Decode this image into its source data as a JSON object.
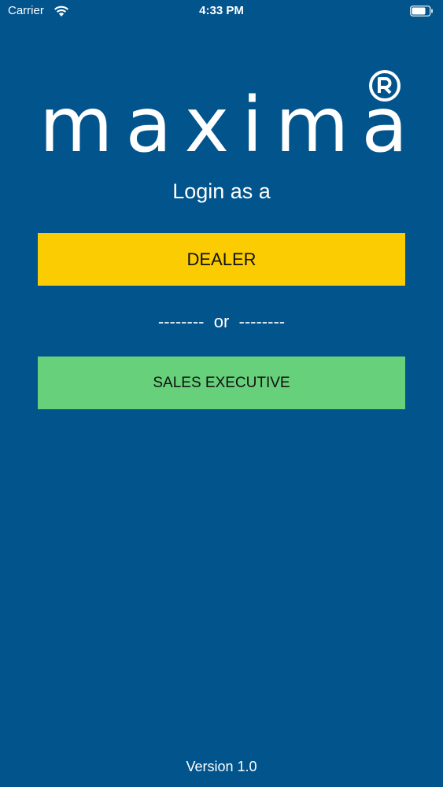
{
  "status_bar": {
    "carrier": "Carrier",
    "time": "4:33 PM",
    "wifi_icon": "wifi-icon",
    "battery_icon": "battery-icon"
  },
  "logo": {
    "text": "maxima",
    "registered_icon": "registered-trademark-icon"
  },
  "login": {
    "prompt": "Login as a",
    "dealer_label": "DEALER",
    "separator": "--------  or  --------",
    "sales_label": "SALES EXECUTIVE"
  },
  "footer": {
    "version": "Version 1.0"
  },
  "colors": {
    "background": "#02548C",
    "dealer_button": "#FBCC02",
    "sales_button": "#67D07A",
    "text": "#FFFFFF",
    "button_text": "#111111"
  }
}
